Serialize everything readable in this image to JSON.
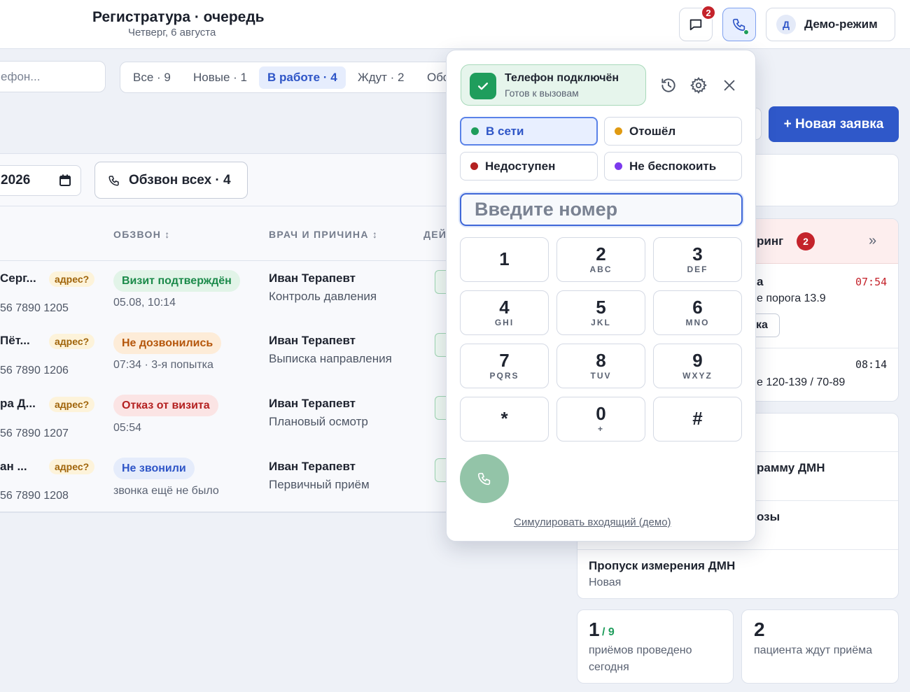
{
  "header": {
    "title": "Регистратура · очередь",
    "subtitle": "Четверг, 6 августа",
    "messages_badge": "2",
    "demo_avatar": "Д",
    "demo_label": "Демо-режим"
  },
  "toolbar": {
    "search_text": "ефон...",
    "tabs": [
      {
        "label": "Все · 9",
        "active": false
      },
      {
        "label": "Новые · 1",
        "active": false
      },
      {
        "label": "В работе · 4",
        "active": true
      },
      {
        "label": "Ждут · 2",
        "active": false
      },
      {
        "label": "Обс",
        "active": false
      }
    ],
    "new_request_label": "+ Новая заявка",
    "date_value": "2026",
    "call_all_label": "Обзвон всех · 4"
  },
  "table": {
    "columns": [
      "ОБЗВОН ↕",
      "ВРАЧ И ПРИЧИНА ↕",
      "ДЕЙ"
    ],
    "rows": [
      {
        "name": "Серг...",
        "phone": "56 7890 1205",
        "addr": "адрес?",
        "status": "Визит подтверждён",
        "status_kind": "green",
        "sub": "05.08, 10:14",
        "doctor": "Иван Терапевт",
        "reason": "Контроль давления"
      },
      {
        "name": "Пёт...",
        "phone": "56 7890 1206",
        "addr": "адрес?",
        "status": "Не дозвонились",
        "status_kind": "orange",
        "sub": "07:34 · 3-я попытка",
        "doctor": "Иван Терапевт",
        "reason": "Выписка направления"
      },
      {
        "name": "ра Д...",
        "phone": "56 7890 1207",
        "addr": "адрес?",
        "status": "Отказ от визита",
        "status_kind": "red",
        "sub": "05:54",
        "doctor": "Иван Терапевт",
        "reason": "Плановый осмотр"
      },
      {
        "name": "ан ...",
        "phone": "56 7890 1208",
        "addr": "адрес?",
        "status": "Не звонили",
        "status_kind": "blue",
        "sub": "звонка ещё не было",
        "doctor": "Иван Терапевт",
        "reason": "Первичный приём"
      }
    ]
  },
  "monitoring": {
    "title": "ринг",
    "badge": "2",
    "expand": "»",
    "alerts": [
      {
        "title": "а",
        "time": "07:54",
        "text": "е порога 13.9",
        "action": "ка"
      },
      {
        "time": "08:14",
        "text": "е 120-139 / 70-89"
      }
    ]
  },
  "tasks": [
    {
      "title": "рамму ДМН",
      "sub": ""
    },
    {
      "title": "озы",
      "sub": ""
    },
    {
      "title": "Пропуск измерения ДМН",
      "sub": "Новая"
    }
  ],
  "stats": [
    {
      "big": "1",
      "small": "/ 9",
      "label": "приёмов проведено сегодня"
    },
    {
      "big": "2",
      "small": "",
      "label": "пациента ждут приёма"
    }
  ],
  "phone": {
    "conn_title": "Телефон подключён",
    "conn_sub": "Готов к вызовам",
    "statuses": [
      {
        "label": "В сети",
        "color": "#1f9d5c",
        "active": true
      },
      {
        "label": "Отошёл",
        "color": "#e09a12",
        "active": false
      },
      {
        "label": "Недоступен",
        "color": "#b42121",
        "active": false
      },
      {
        "label": "Не беспокоить",
        "color": "#7c3aed",
        "active": false
      }
    ],
    "input_placeholder": "Введите номер",
    "keys": [
      {
        "d": "1",
        "l": ""
      },
      {
        "d": "2",
        "l": "ABC"
      },
      {
        "d": "3",
        "l": "DEF"
      },
      {
        "d": "4",
        "l": "GHI"
      },
      {
        "d": "5",
        "l": "JKL"
      },
      {
        "d": "6",
        "l": "MNO"
      },
      {
        "d": "7",
        "l": "PQRS"
      },
      {
        "d": "8",
        "l": "TUV"
      },
      {
        "d": "9",
        "l": "WXYZ"
      },
      {
        "d": "*",
        "l": ""
      },
      {
        "d": "0",
        "l": "+"
      },
      {
        "d": "#",
        "l": ""
      }
    ],
    "simulate_label": "Симулировать входящий (демо)"
  }
}
